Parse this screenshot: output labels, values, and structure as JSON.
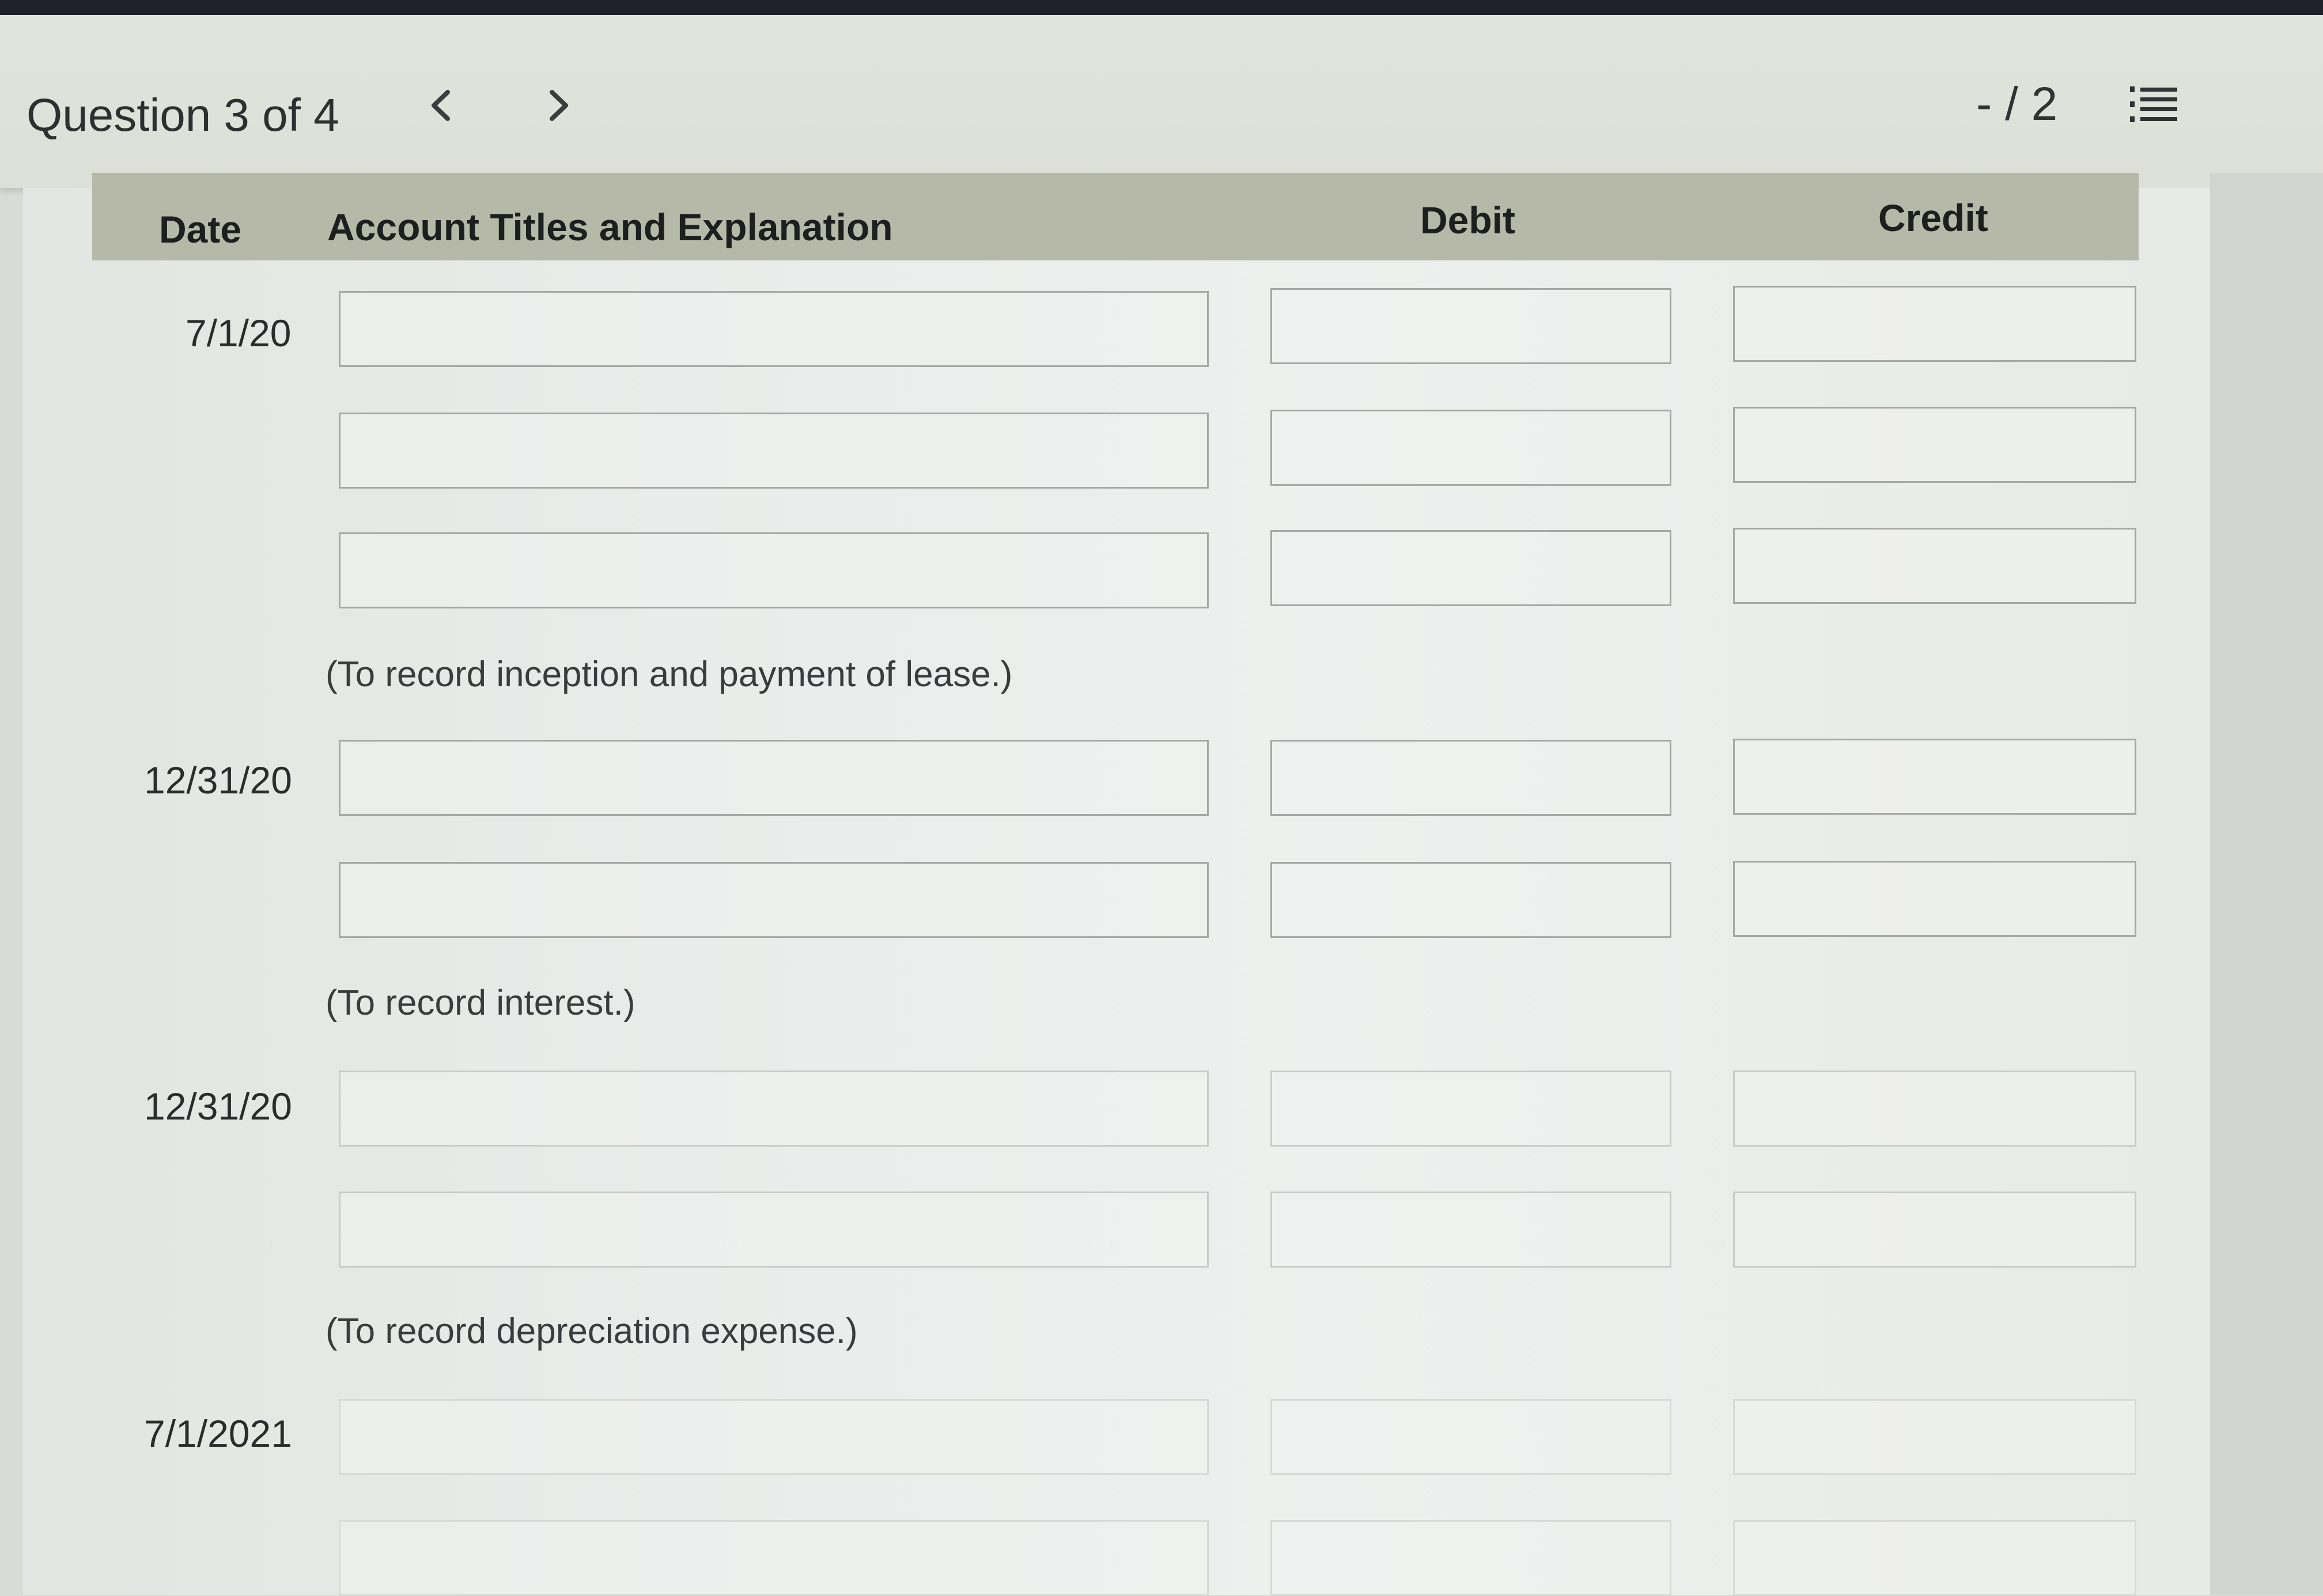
{
  "header": {
    "question_label": "Question 3 of 4",
    "prev_glyph": "‹",
    "next_glyph": "›",
    "score": "- / 2",
    "list_icon": "list-icon"
  },
  "table": {
    "columns": {
      "date": "Date",
      "account": "Account Titles and Explanation",
      "debit": "Debit",
      "credit": "Credit"
    },
    "entries": [
      {
        "date": "7/1/20",
        "rows": 3,
        "note": "(To record inception and payment of lease.)"
      },
      {
        "date": "12/31/20",
        "rows": 2,
        "note": "(To record interest.)"
      },
      {
        "date": "12/31/20",
        "rows": 2,
        "note": "(To record depreciation expense.)"
      },
      {
        "date": "7/1/2021",
        "rows": 2,
        "note": ""
      }
    ]
  },
  "colors": {
    "header_row": "#b6b9a8",
    "background": "#e9ecea",
    "field_border": "#a5a8a4"
  }
}
